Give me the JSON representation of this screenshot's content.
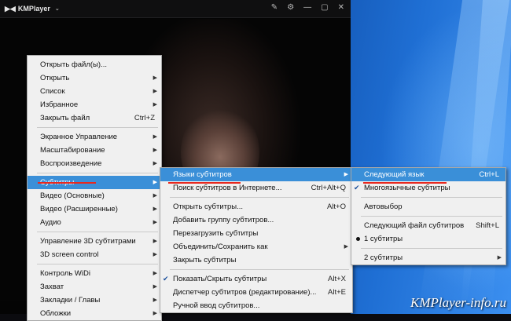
{
  "app": {
    "title": "KMPlayer"
  },
  "main_menu": [
    {
      "label": "Открыть файл(ы)...",
      "shortcut": "",
      "submenu": false
    },
    {
      "label": "Открыть",
      "shortcut": "",
      "submenu": true
    },
    {
      "label": "Список",
      "shortcut": "",
      "submenu": true
    },
    {
      "label": "Избранное",
      "shortcut": "",
      "submenu": true
    },
    {
      "label": "Закрыть файл",
      "shortcut": "Ctrl+Z",
      "submenu": false
    },
    {
      "label": "Экранное Управление",
      "shortcut": "",
      "submenu": true
    },
    {
      "label": "Масштабирование",
      "shortcut": "",
      "submenu": true
    },
    {
      "label": "Воспроизведение",
      "shortcut": "",
      "submenu": true
    },
    {
      "label": "Субтитры",
      "shortcut": "",
      "submenu": true
    },
    {
      "label": "Видео (Основные)",
      "shortcut": "",
      "submenu": true
    },
    {
      "label": "Видео (Расширенные)",
      "shortcut": "",
      "submenu": true
    },
    {
      "label": "Аудио",
      "shortcut": "",
      "submenu": true
    },
    {
      "label": "Управление 3D субтитрами",
      "shortcut": "",
      "submenu": true
    },
    {
      "label": "3D screen control",
      "shortcut": "",
      "submenu": true
    },
    {
      "label": "Контроль WiDi",
      "shortcut": "",
      "submenu": true
    },
    {
      "label": "Захват",
      "shortcut": "",
      "submenu": true
    },
    {
      "label": "Закладки / Главы",
      "shortcut": "",
      "submenu": true
    },
    {
      "label": "Обложки",
      "shortcut": "",
      "submenu": true
    }
  ],
  "subtitles_menu": [
    {
      "label": "Языки субтитров",
      "shortcut": "",
      "submenu": true
    },
    {
      "label": "Поиск субтитров в Интернете...",
      "shortcut": "Ctrl+Alt+Q",
      "submenu": false
    },
    {
      "label": "Открыть субтитры...",
      "shortcut": "Alt+O",
      "submenu": false
    },
    {
      "label": "Добавить группу субтитров...",
      "shortcut": "",
      "submenu": false
    },
    {
      "label": "Перезагрузить субтитры",
      "shortcut": "",
      "submenu": false
    },
    {
      "label": "Объединить/Сохранить как",
      "shortcut": "",
      "submenu": true
    },
    {
      "label": "Закрыть субтитры",
      "shortcut": "",
      "submenu": false
    },
    {
      "label": "Показать/Скрыть субтитры",
      "shortcut": "Alt+X",
      "submenu": false,
      "checked": true
    },
    {
      "label": "Диспетчер субтитров (редактирование)...",
      "shortcut": "Alt+E",
      "submenu": false
    },
    {
      "label": "Ручной ввод субтитров...",
      "shortcut": "",
      "submenu": false
    }
  ],
  "languages_menu": [
    {
      "label": "Следующий язык",
      "shortcut": "Ctrl+L"
    },
    {
      "label": "Многоязычные субтитры",
      "shortcut": "",
      "checked": true
    },
    {
      "label": "Автовыбор",
      "shortcut": ""
    },
    {
      "label": "Следующий файл субтитров",
      "shortcut": "Shift+L"
    },
    {
      "label": "1 субтитры",
      "shortcut": "",
      "selected": true
    },
    {
      "label": "2 субтитры",
      "shortcut": "",
      "submenu": true
    }
  ],
  "watermark": "KMPlayer-info.ru",
  "colors": {
    "highlight": "#3a8fd8",
    "underline": "#e8281e"
  }
}
